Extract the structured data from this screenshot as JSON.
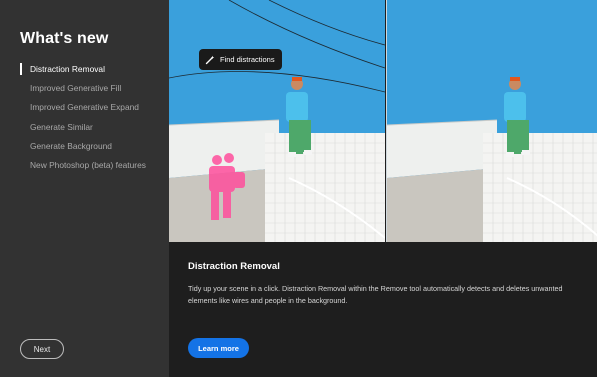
{
  "sidebar": {
    "title": "What's new",
    "items": [
      {
        "label": "Distraction Removal",
        "active": true
      },
      {
        "label": "Improved Generative Fill",
        "active": false
      },
      {
        "label": "Improved Generative Expand",
        "active": false
      },
      {
        "label": "Generate Similar",
        "active": false
      },
      {
        "label": "Generate Background",
        "active": false
      },
      {
        "label": "New Photoshop (beta) features",
        "active": false
      }
    ],
    "next_label": "Next"
  },
  "preview": {
    "chip_label": "Find distractions",
    "chip_icon": "magic-wand-icon"
  },
  "feature": {
    "title": "Distraction Removal",
    "description": "Tidy up your scene in a click. Distraction Removal within the Remove tool automatically detects and deletes unwanted elements like wires and people in the background.",
    "learn_more_label": "Learn more"
  },
  "colors": {
    "sidebar_bg": "#323232",
    "panel_bg": "#1e1e1e",
    "accent": "#1473e6",
    "highlight": "#ff3c8c",
    "sky": "#3aa0dc"
  }
}
